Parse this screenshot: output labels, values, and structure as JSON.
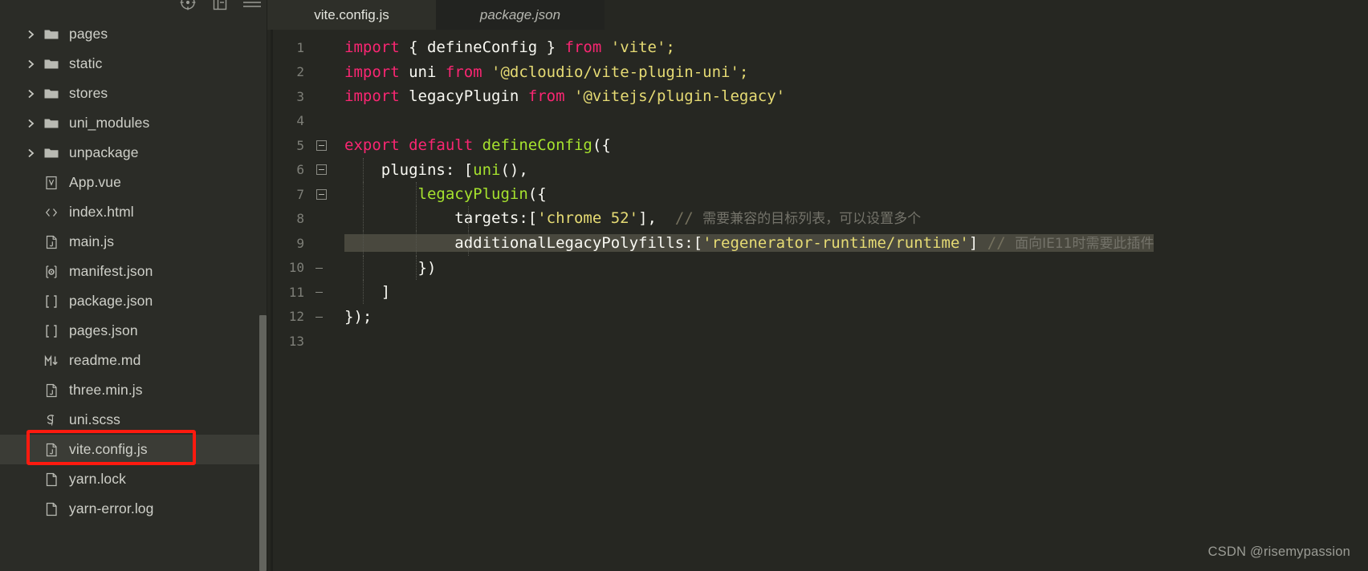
{
  "sidebar": {
    "toolbar": [
      {
        "name": "collapse-target-icon",
        "label": "Reveal in Explorer"
      },
      {
        "name": "collapse-all-icon",
        "label": "Collapse All"
      },
      {
        "name": "menu-icon",
        "label": "More Actions"
      }
    ],
    "items": [
      {
        "label": "pages",
        "type": "folder",
        "expandable": true,
        "icon": "folder-icon",
        "selected": false
      },
      {
        "label": "static",
        "type": "folder",
        "expandable": true,
        "icon": "folder-icon",
        "selected": false
      },
      {
        "label": "stores",
        "type": "folder",
        "expandable": true,
        "icon": "folder-icon",
        "selected": false
      },
      {
        "label": "uni_modules",
        "type": "folder",
        "expandable": true,
        "icon": "folder-icon",
        "selected": false
      },
      {
        "label": "unpackage",
        "type": "folder",
        "expandable": true,
        "icon": "folder-icon",
        "selected": false
      },
      {
        "label": "App.vue",
        "type": "file",
        "expandable": false,
        "icon": "vue-file-icon",
        "selected": false
      },
      {
        "label": "index.html",
        "type": "file",
        "expandable": false,
        "icon": "html-file-icon",
        "selected": false
      },
      {
        "label": "main.js",
        "type": "file",
        "expandable": false,
        "icon": "js-file-icon",
        "selected": false
      },
      {
        "label": "manifest.json",
        "type": "file",
        "expandable": false,
        "icon": "manifest-file-icon",
        "selected": false
      },
      {
        "label": "package.json",
        "type": "file",
        "expandable": false,
        "icon": "json-file-icon",
        "selected": false
      },
      {
        "label": "pages.json",
        "type": "file",
        "expandable": false,
        "icon": "json-file-icon",
        "selected": false
      },
      {
        "label": "readme.md",
        "type": "file",
        "expandable": false,
        "icon": "markdown-file-icon",
        "selected": false
      },
      {
        "label": "three.min.js",
        "type": "file",
        "expandable": false,
        "icon": "js-file-icon",
        "selected": false
      },
      {
        "label": "uni.scss",
        "type": "file",
        "expandable": false,
        "icon": "scss-file-icon",
        "selected": false
      },
      {
        "label": "vite.config.js",
        "type": "file",
        "expandable": false,
        "icon": "js-file-icon",
        "selected": true
      },
      {
        "label": "yarn.lock",
        "type": "file",
        "expandable": false,
        "icon": "plain-file-icon",
        "selected": false
      },
      {
        "label": "yarn-error.log",
        "type": "file",
        "expandable": false,
        "icon": "plain-file-icon",
        "selected": false
      }
    ]
  },
  "tabs": [
    {
      "label": "vite.config.js",
      "active": true,
      "preview": false
    },
    {
      "label": "package.json",
      "active": false,
      "preview": true
    }
  ],
  "editor": {
    "lines": [
      {
        "no": "1",
        "fold": "box-open"
      },
      {
        "no": "2",
        "fold": "none"
      },
      {
        "no": "3",
        "fold": "none"
      },
      {
        "no": "4",
        "fold": "none"
      },
      {
        "no": "5",
        "fold": "box"
      },
      {
        "no": "6",
        "fold": "box"
      },
      {
        "no": "7",
        "fold": "box"
      },
      {
        "no": "8",
        "fold": "bar"
      },
      {
        "no": "9",
        "fold": "bar"
      },
      {
        "no": "10",
        "fold": "bar-end"
      },
      {
        "no": "11",
        "fold": "bar-end"
      },
      {
        "no": "12",
        "fold": "bar-close"
      },
      {
        "no": "13",
        "fold": "none"
      }
    ],
    "code": {
      "l1_kw_import": "import",
      "l1_braces": " { defineConfig } ",
      "l1_kw_from": "from",
      "l1_str": " 'vite';",
      "l2_kw_import": "import",
      "l2_name": " uni ",
      "l2_kw_from": "from",
      "l2_str": " '@dcloudio/vite-plugin-uni';",
      "l3_kw_import": "import",
      "l3_name": " legacyPlugin ",
      "l3_kw_from": "from",
      "l3_str": " '@vitejs/plugin-legacy'",
      "l5_kw_export": "export",
      "l5_kw_default": " default",
      "l5_fn": " defineConfig",
      "l5_tail": "({",
      "l6_key": "    plugins: [",
      "l6_fn": "uni",
      "l6_tail": "(),",
      "l7_fn": "        legacyPlugin",
      "l7_tail": "({",
      "l8_key": "            targets:[",
      "l8_str": "'chrome 52'",
      "l8_tail": "], ",
      "l8_comment_slash": " // ",
      "l8_comment_cn": "需要兼容的目标列表，可以设置多个",
      "l9_key": "            additionalLegacyPolyfills:[",
      "l9_str": "'regenerator-runtime/runtime'",
      "l9_tail": "]",
      "l9_comment_slash": " // ",
      "l9_comment_cn": "面向IE11时需要此插件",
      "l10": "        })",
      "l11": "    ]",
      "l12": "});"
    }
  },
  "watermark": "CSDN @risemypassion",
  "colors": {
    "bg_editor": "#262722",
    "bg_sidebar": "#2b2c27",
    "selection": "#49483e",
    "keyword": "#f92672",
    "function": "#a6e22e",
    "string": "#e6db74",
    "comment": "#75715e",
    "annotation_box": "#ff1a0f",
    "row_selected": "#3b3c36"
  }
}
